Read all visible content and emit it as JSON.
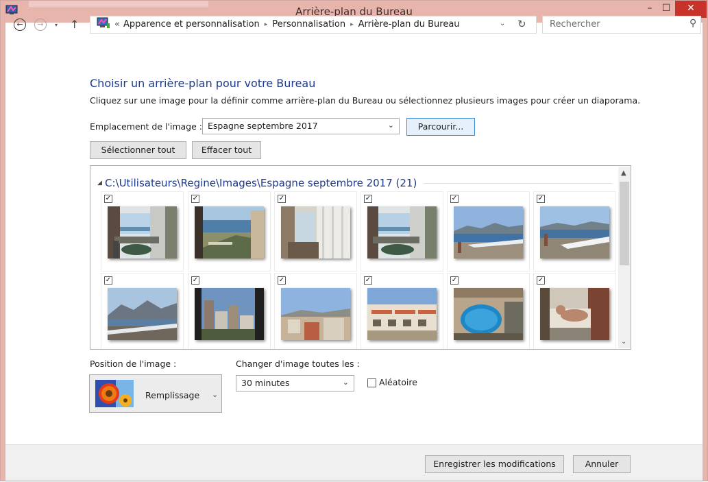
{
  "window": {
    "title": "Arrière-plan du Bureau",
    "minimize_icon": "minimize-icon",
    "maximize_icon": "maximize-icon",
    "close_icon": "close-icon",
    "min_glyph": "–",
    "max_glyph": "☐",
    "close_glyph": "✕",
    "accent": "#e8b5ad",
    "close_color": "#c7322a"
  },
  "navigation": {
    "back_glyph": "←",
    "forward_glyph": "→",
    "history_glyph": "▾",
    "up_glyph": "↑",
    "overflow": "«",
    "breadcrumbs": [
      "Apparence et personnalisation",
      "Personnalisation",
      "Arrière-plan du Bureau"
    ],
    "separator": "▸",
    "dropdown_glyph": "⌄",
    "refresh_glyph": "↻",
    "search_placeholder": "Rechercher",
    "search_glyph": "⚲"
  },
  "main": {
    "heading": "Choisir un arrière-plan pour votre Bureau",
    "description": "Cliquez sur une image pour la définir comme arrière-plan du Bureau ou sélectionnez plusieurs images pour créer un diaporama.",
    "location_label": "Emplacement de l'image :",
    "location_value": "Espagne septembre 2017",
    "browse_label": "Parcourir...",
    "select_all_label": "Sélectionner tout",
    "clear_all_label": "Effacer tout",
    "chevron": "⌄"
  },
  "gallery": {
    "group_title": "C:\\Utilisateurs\\Regine\\Images\\Espagne septembre 2017 (21)",
    "collapse_glyph": "◢",
    "check_glyph": "✓",
    "scroll_up": "▲",
    "scroll_down": "⌄",
    "images": [
      {
        "subject": "balcony-sea-view",
        "checked": true
      },
      {
        "subject": "balcony-coast",
        "checked": true
      },
      {
        "subject": "room-window",
        "checked": true
      },
      {
        "subject": "balcony-table",
        "checked": true
      },
      {
        "subject": "beach-mountains",
        "checked": true
      },
      {
        "subject": "beach-waves",
        "checked": true
      },
      {
        "subject": "beach-bay-mountains",
        "checked": true
      },
      {
        "subject": "city-buildings",
        "checked": true
      },
      {
        "subject": "rooftops",
        "checked": true
      },
      {
        "subject": "apartment-block",
        "checked": true
      },
      {
        "subject": "pool-from-above",
        "checked": true
      },
      {
        "subject": "man-resting",
        "checked": true
      }
    ]
  },
  "options": {
    "position_label": "Position de l'image :",
    "position_value": "Remplissage",
    "change_label": "Changer d'image toutes les :",
    "change_value": "30 minutes",
    "random_label": "Aléatoire",
    "random_checked": false
  },
  "footer": {
    "save_label": "Enregistrer les modifications",
    "cancel_label": "Annuler"
  }
}
